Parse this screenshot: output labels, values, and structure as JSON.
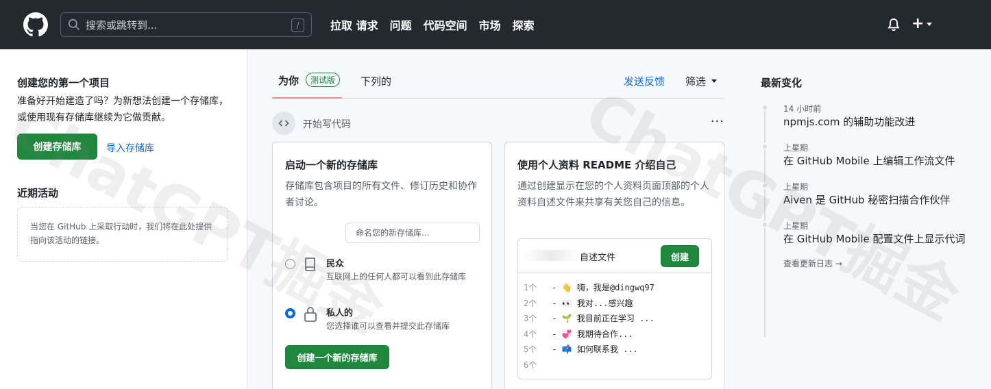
{
  "header": {
    "search_placeholder": "搜索或跳转到...",
    "search_shortcut": "/",
    "nav": [
      "拉取 请求",
      "问题",
      "代码空间",
      "市场",
      "探索"
    ],
    "plus_symbol": "+"
  },
  "left": {
    "first_project_title": "创建您的第一个项目",
    "first_project_desc": "准备好开始建造了吗？为新想法创建一个存储库，或使用现有存储库继续为它做贡献。",
    "create_repo_label": "创建存储库",
    "import_repo_label": "导入存储库",
    "recent_activity_title": "近期活动",
    "recent_activity_empty": "当您在 GitHub 上采取行动时，我们将在此处提供指向该活动的链接。"
  },
  "feed": {
    "tabs": {
      "for_you": "为你",
      "beta": "测试版",
      "following": "下列的",
      "feedback": "发送反馈",
      "filter": "筛选"
    },
    "section_label": "开始写代码",
    "kebab": "···",
    "new_repo_card": {
      "title": "启动一个新的存储库",
      "desc": "存储库包含项目的所有文件、修订历史和协作者讨论。",
      "name_placeholder": "命名您的新存储库...",
      "public_title": "民众",
      "public_desc": "互联网上的任何人都可以看到此存储库",
      "private_title": "私人的",
      "private_desc": "您选择谁可以查看并提交此存储库",
      "create_label": "创建一个新的存储库"
    },
    "readme_card": {
      "title": "使用个人资料 README 介绍自己",
      "desc": "通过创建显示在您的个人资料页面顶部的个人资料自述文件来共享有关您自己的信息。",
      "file_label": "自述文件",
      "create_label": "创建",
      "lines": [
        {
          "num": "1个",
          "text": " - 👋 嗨，我是@dingwq97"
        },
        {
          "num": "2个",
          "text": " - 👀 我对...感兴趣"
        },
        {
          "num": "3个",
          "text": " - 🌱 我目前正在学习 ..."
        },
        {
          "num": "4个",
          "text": " - 💞️ 我期待合作..."
        },
        {
          "num": "5个",
          "text": " - 📫 如何联系我 ..."
        },
        {
          "num": "6个",
          "text": ""
        }
      ]
    }
  },
  "right": {
    "title": "最新变化",
    "changes": [
      {
        "when": "14 小时前",
        "what": "npmjs.com 的辅助功能改进"
      },
      {
        "when": "上星期",
        "what": "在 GitHub Mobile 上编辑工作流文件"
      },
      {
        "when": "上星期",
        "what": "Aiven 是 GitHub 秘密扫描合作伙伴"
      },
      {
        "when": "上星期",
        "what": "在 GitHub Mobile 配置文件上显示代词"
      }
    ],
    "changelog_link": "查看更新日志 →"
  },
  "watermark": "ChatGPT掘金",
  "colors": {
    "header_bg": "#24292f",
    "primary_green": "#1f883d",
    "link_blue": "#0969da",
    "tab_underline": "#fd8c73"
  }
}
